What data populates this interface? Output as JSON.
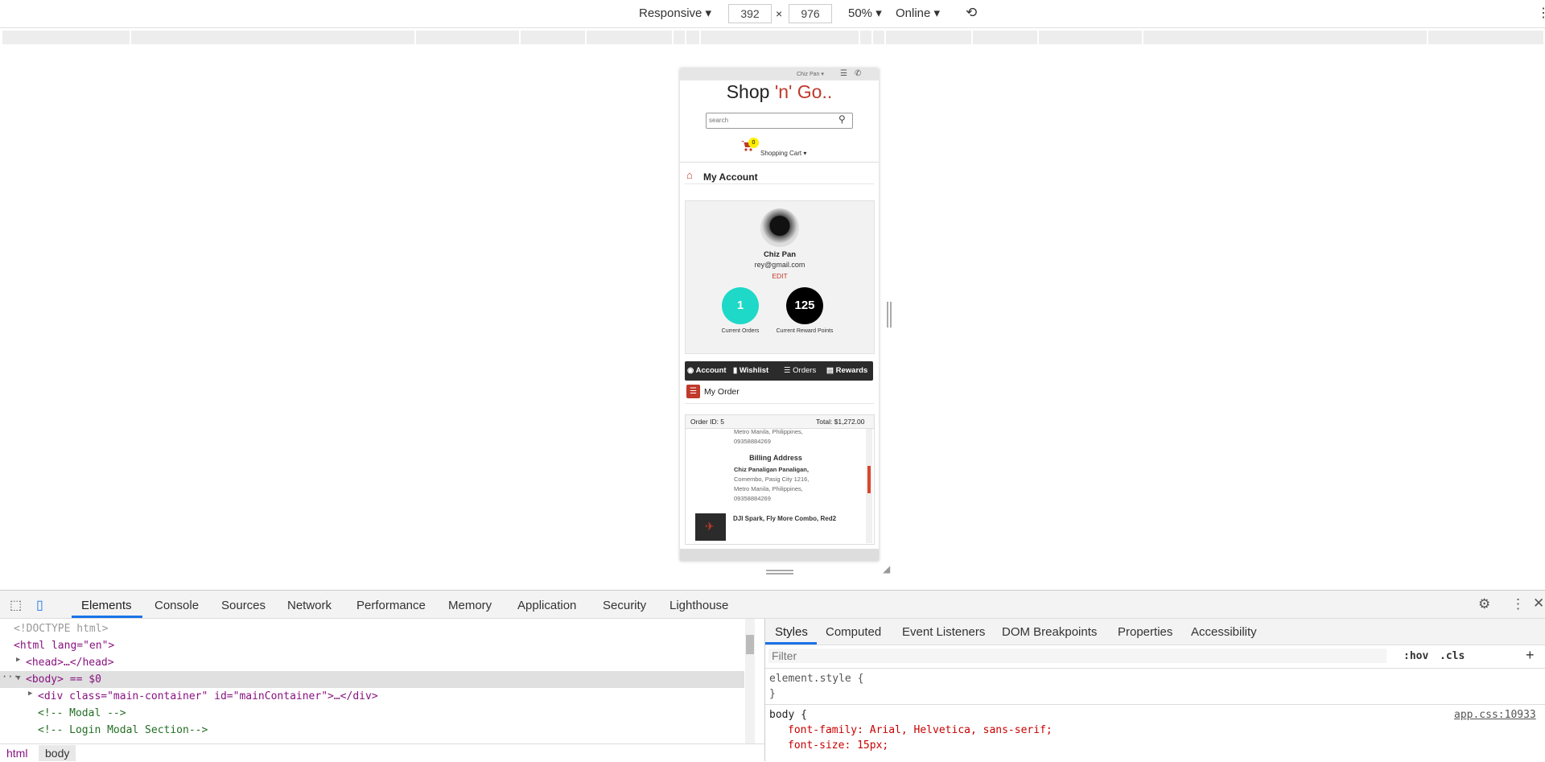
{
  "device_toolbar": {
    "mode": "Responsive",
    "width": "392",
    "x": "×",
    "height": "976",
    "zoom": "50%",
    "network": "Online"
  },
  "site": {
    "user_menu": "Chiz Pan",
    "brand_prefix": "Shop ",
    "brand_accent": "'n' Go..",
    "search_placeholder": "search",
    "cart_count": "0",
    "cart_label": "Shopping Cart",
    "page_title": "My Account",
    "profile": {
      "name": "Chiz Pan",
      "email": "rey@gmail.com",
      "edit": "EDIT"
    },
    "stats": {
      "orders_value": "1",
      "orders_label": "Current Orders",
      "rewards_value": "125",
      "rewards_label": "Current Reward Points"
    },
    "tabs": [
      "Account",
      "Wishlist",
      "Orders",
      "Rewards"
    ],
    "section_title": "My Order",
    "order": {
      "id": "Order ID: 5",
      "total": "Total: $1,272.00",
      "shipping_tail_1": "Metro Manila, Philippines,",
      "shipping_tail_2": "09358884269",
      "billing_title": "Billing Address",
      "billing_name": "Chiz Panaligan Panaligan,",
      "billing_line1": "Comembo, Pasig City 1216,",
      "billing_line2": "Metro Manila, Philippines,",
      "billing_line3": "09358884269",
      "item_name": "DJI Spark, Fly More Combo, Red2"
    }
  },
  "devtools": {
    "tabs": [
      "Elements",
      "Console",
      "Sources",
      "Network",
      "Performance",
      "Memory",
      "Application",
      "Security",
      "Lighthouse"
    ],
    "code": {
      "l1": "<!DOCTYPE html>",
      "l2": "<html lang=\"en\">",
      "l3": "<head>…</head>",
      "l4": "<body> == $0",
      "l5": "<div class=\"main-container\" id=\"mainContainer\">…</div>",
      "l6": "<!-- Modal -->",
      "l7": "<!-- Login Modal Section-->"
    },
    "breadcrumb": [
      "html",
      "body"
    ],
    "style_tabs": [
      "Styles",
      "Computed",
      "Event Listeners",
      "DOM Breakpoints",
      "Properties",
      "Accessibility"
    ],
    "filter_placeholder": "Filter",
    "hov": ":hov",
    "cls": ".cls",
    "plus": "+",
    "element_style": "element.style {",
    "close_brace": "}",
    "body_rule": "body {",
    "source_link": "app.css:10933",
    "prop1": "font-family: Arial, Helvetica, sans-serif;",
    "prop2": "font-size: 15px;"
  },
  "colors": {
    "accent": "#c0392b",
    "orders_circle": "#1ed8c8",
    "rewards_circle": "#000000",
    "devtools_active": "#1a73e8"
  }
}
